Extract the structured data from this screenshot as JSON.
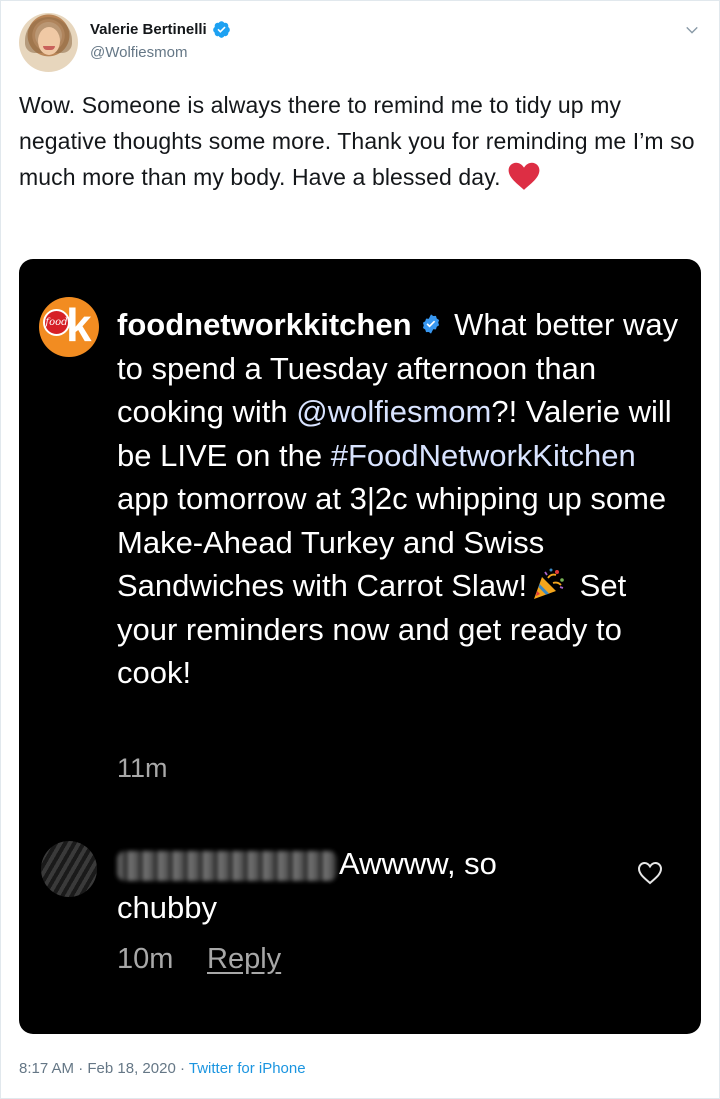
{
  "author": {
    "display_name": "Valerie Bertinelli",
    "handle": "@Wolfiesmom"
  },
  "tweet": {
    "text": "Wow. Someone is always there to remind me to tidy up my negative thoughts some more. Thank you for reminding me I’m so much more than my body. Have a blessed day."
  },
  "embedded_post": {
    "username": "foodnetworkkitchen",
    "caption_1": " What better way to spend a Tuesday afternoon than cooking with ",
    "mention": "@wolfiesmom",
    "caption_2": "?! Valerie will be LIVE on the ",
    "hashtag": "#FoodNetworkKitchen",
    "caption_3": " app tomorrow at 3|2c whipping up some Make-Ahead Turkey and Swiss Sandwiches with Carrot Slaw!",
    "caption_4": " Set your reminders now and get ready to cook!",
    "time": "11m",
    "logo_text": "food",
    "logo_letter": "k"
  },
  "comment": {
    "text": "Awwww, so chubby",
    "time": "10m",
    "reply_label": "Reply"
  },
  "footer": {
    "time": "8:17 AM",
    "sep1": " · ",
    "date": "Feb 18, 2020",
    "sep2": " · ",
    "source": "Twitter for iPhone"
  },
  "icons": {
    "verified": "verified-badge-icon",
    "menu": "chevron-down-icon",
    "heart": "red-heart-icon",
    "party": "party-popper-icon",
    "like": "heart-outline-icon"
  },
  "colors": {
    "twitter_blue": "#1da1f2",
    "link_blue": "#1b95e0",
    "heart_red": "#e0245e",
    "food_network_orange": "#f28c21"
  }
}
